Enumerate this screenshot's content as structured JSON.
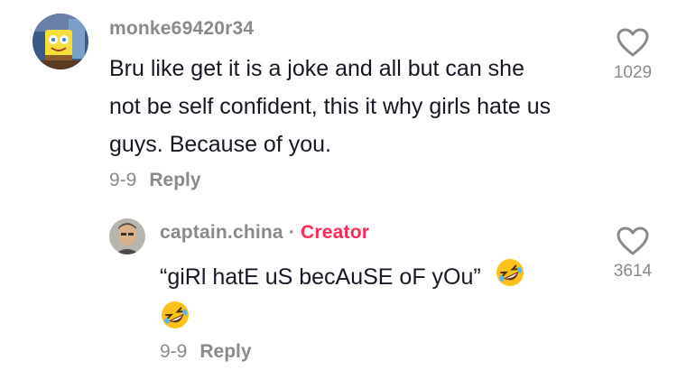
{
  "comments": [
    {
      "username": "monke69420r34",
      "text": "Bru like get it is a joke and all but can she not be self confident, this it why girls hate us guys. Because of you.",
      "date": "9-9",
      "reply_label": "Reply",
      "likes": "1029",
      "icons": {
        "like": "heart-outline-icon",
        "avatar": "spongebob-avatar"
      }
    }
  ],
  "reply": {
    "username": "captain.china",
    "separator": "·",
    "badge": "Creator",
    "text": "“giRl hatE uS becAuSE oF yOu”",
    "date": "9-9",
    "reply_label": "Reply",
    "likes": "3614",
    "icons": {
      "like": "heart-outline-icon",
      "emoji": "rolling-on-floor-laughing-emoji",
      "avatar": "user-photo-avatar"
    }
  },
  "colors": {
    "text": "#161823",
    "muted": "#8a8a8a",
    "creator": "#fe2c55",
    "background": "#ffffff"
  }
}
